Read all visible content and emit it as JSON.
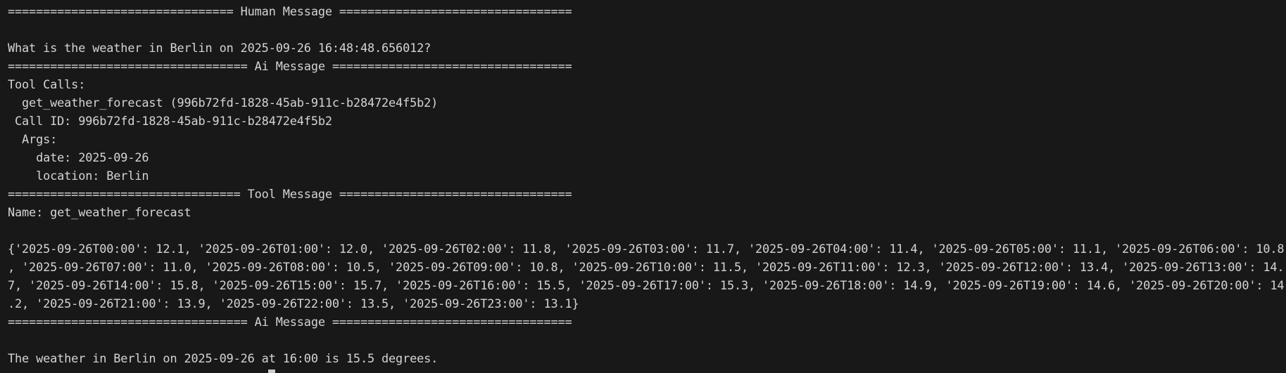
{
  "terminal": {
    "human_header": "================================ Human Message =================================",
    "human_blank": "",
    "human_text": "What is the weather in Berlin on 2025-09-26 16:48:48.656012?",
    "ai1_header": "================================== Ai Message ==================================",
    "tool_calls_label": "Tool Calls:",
    "tool_call_name": "  get_weather_forecast (996b72fd-1828-45ab-911c-b28472e4f5b2)",
    "call_id": " Call ID: 996b72fd-1828-45ab-911c-b28472e4f5b2",
    "args_label": "  Args:",
    "arg_date": "    date: 2025-09-26",
    "arg_location": "    location: Berlin",
    "tool_header": "================================= Tool Message =================================",
    "tool_name": "Name: get_weather_forecast",
    "tool_blank": "",
    "tool_output_1": "{'2025-09-26T00:00': 12.1, '2025-09-26T01:00': 12.0, '2025-09-26T02:00': 11.8, '2025-09-26T03:00': 11.7, '2025-09-26T04:00': 11.4, '2025-09-26T05:00': 11.1, '2025-09-26T06:00': 10.8",
    "tool_output_2": ", '2025-09-26T07:00': 11.0, '2025-09-26T08:00': 10.5, '2025-09-26T09:00': 10.8, '2025-09-26T10:00': 11.5, '2025-09-26T11:00': 12.3, '2025-09-26T12:00': 13.4, '2025-09-26T13:00': 14.",
    "tool_output_3": "7, '2025-09-26T14:00': 15.8, '2025-09-26T15:00': 15.7, '2025-09-26T16:00': 15.5, '2025-09-26T17:00': 15.3, '2025-09-26T18:00': 14.9, '2025-09-26T19:00': 14.6, '2025-09-26T20:00': 14",
    "tool_output_4": ".2, '2025-09-26T21:00': 13.9, '2025-09-26T22:00': 13.5, '2025-09-26T23:00': 13.1}",
    "ai2_header": "================================== Ai Message ==================================",
    "ai2_blank": "",
    "ai2_text": "The weather in Berlin on 2025-09-26 at 16:00 is 15.5 degrees."
  },
  "colors": {
    "background": "#181818",
    "text": "#d4d4d4",
    "cursor": "#cccccc"
  }
}
